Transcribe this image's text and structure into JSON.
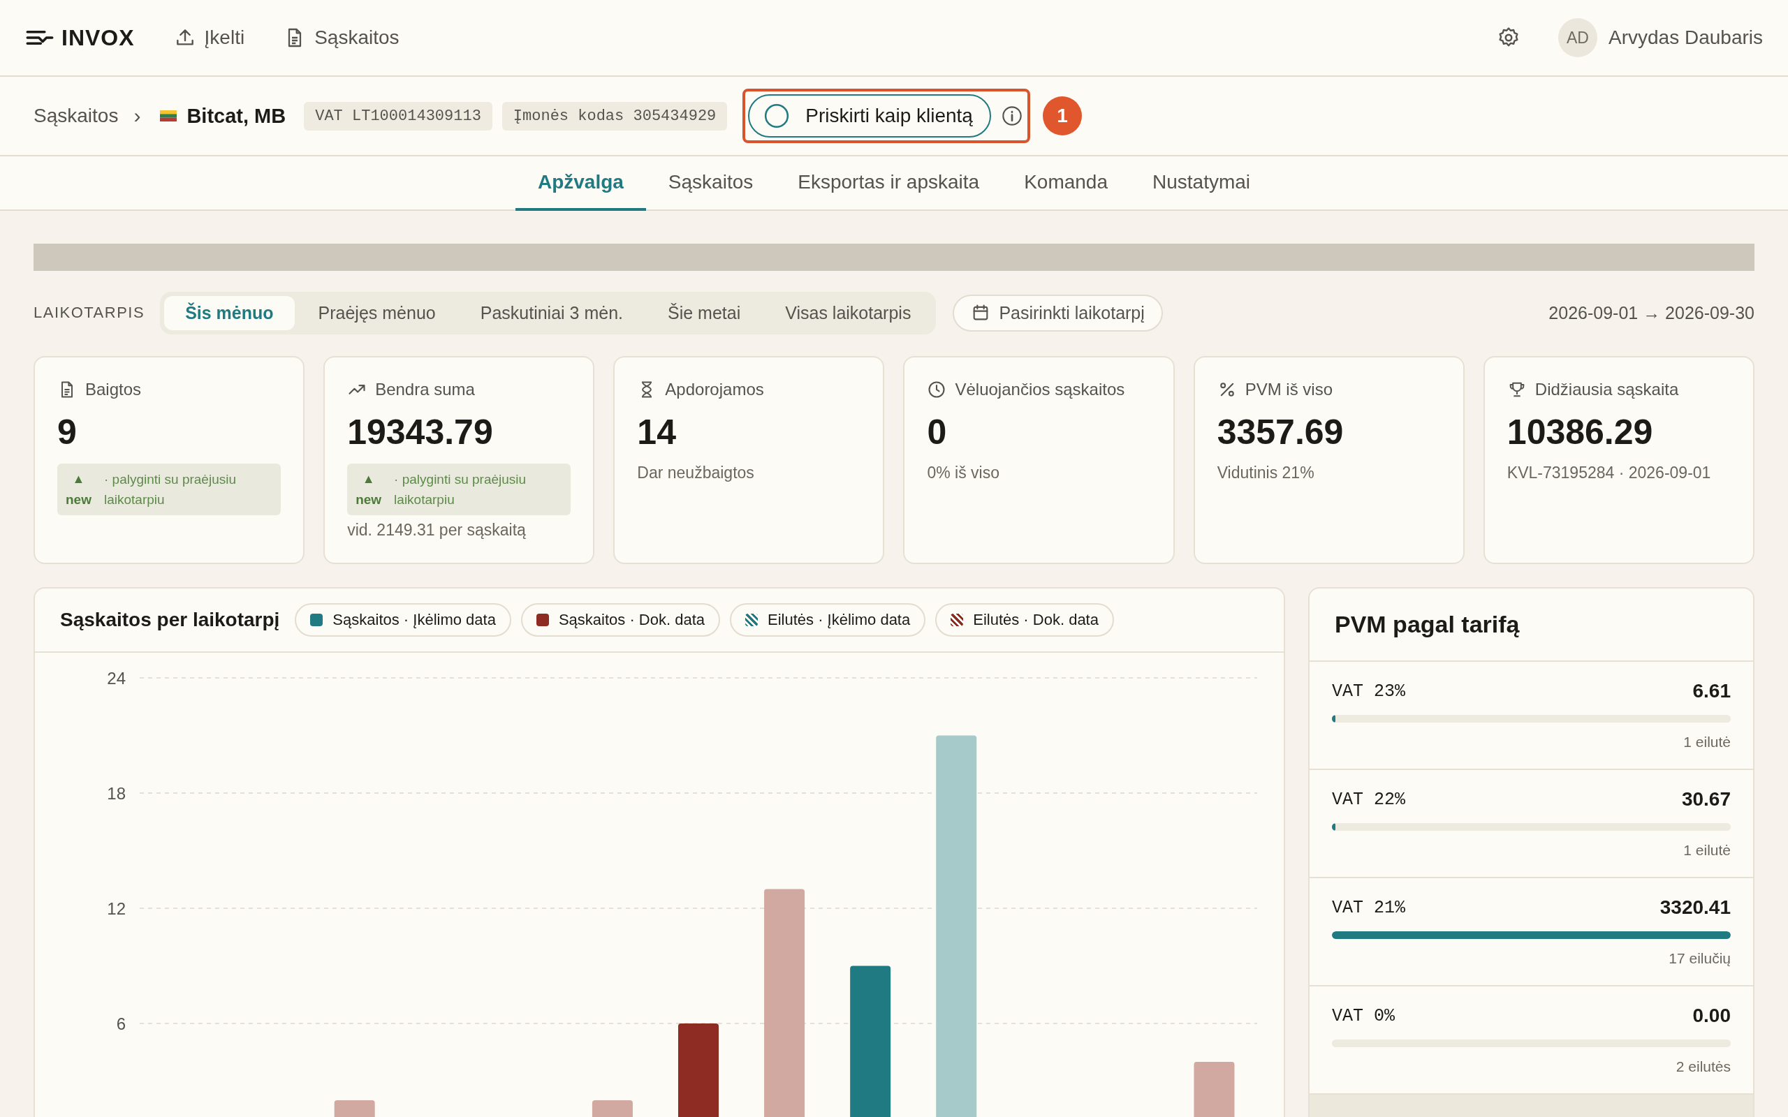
{
  "app": {
    "logo": "INVOX",
    "nav": [
      {
        "label": "Įkelti"
      },
      {
        "label": "Sąskaitos"
      }
    ],
    "user": {
      "initials": "AD",
      "name": "Arvydas Daubaris"
    }
  },
  "breadcrumb": {
    "parent": "Sąskaitos",
    "separator": "›",
    "company": "Bitcat, MB",
    "chips": [
      "VAT LT100014309113",
      "Įmonės kodas 305434929"
    ],
    "assign_button": "Priskirti kaip klientą",
    "step_badge": "1"
  },
  "tabs": [
    {
      "label": "Apžvalga",
      "selected": true
    },
    {
      "label": "Sąskaitos",
      "selected": false
    },
    {
      "label": "Eksportas ir apskaita",
      "selected": false
    },
    {
      "label": "Komanda",
      "selected": false
    },
    {
      "label": "Nustatymai",
      "selected": false
    }
  ],
  "period": {
    "label": "LAIKOTARPIS",
    "options": [
      {
        "label": "Šis mėnuo",
        "selected": true
      },
      {
        "label": "Praėjęs mėnuo",
        "selected": false
      },
      {
        "label": "Paskutiniai 3 mėn.",
        "selected": false
      },
      {
        "label": "Šie metai",
        "selected": false
      },
      {
        "label": "Visas laikotarpis",
        "selected": false
      }
    ],
    "custom_button": "Pasirinkti laikotarpį",
    "range": "2026-09-01 → 2026-09-30"
  },
  "stats": [
    {
      "title": "Baigtos",
      "value": "9",
      "delta": {
        "arrow": "▲",
        "label": "new",
        "text": "· palyginti su praėjusiu laikotarpiu"
      }
    },
    {
      "title": "Bendra suma",
      "value": "19343.79",
      "delta": {
        "arrow": "▲",
        "label": "new",
        "text": "· palyginti su praėjusiu laikotarpiu"
      },
      "note": "vid. 2149.31 per sąskaitą"
    },
    {
      "title": "Apdorojamos",
      "value": "14",
      "note": "Dar neužbaigtos"
    },
    {
      "title": "Vėluojančios sąskaitos",
      "value": "0",
      "note": "0% iš viso"
    },
    {
      "title": "PVM iš viso",
      "value": "3357.69",
      "note": "Vidutinis 21%"
    },
    {
      "title": "Didžiausia sąskaita",
      "value": "10386.29",
      "note": "KVL-73195284 · 2026-09-01"
    }
  ],
  "invoices_chart": {
    "title": "Sąskaitos per laikotarpį",
    "swatches": [
      {
        "kind": "solid",
        "color": "#1f7a82"
      },
      {
        "kind": "solid",
        "color": "#8e2b22"
      },
      {
        "kind": "striped",
        "color": "#1f7a82"
      },
      {
        "kind": "striped",
        "color": "#8e2b22"
      }
    ],
    "chart_data": {
      "type": "bar",
      "grid": true,
      "ylim": [
        0,
        24
      ],
      "yticks": [
        6,
        12,
        18,
        24
      ],
      "series": [
        {
          "name": "Sąskaitos · Įkėlimo data",
          "color": "#1f7a82",
          "values": [
            null,
            null,
            null,
            null,
            null,
            null,
            null,
            null,
            9,
            null,
            null,
            null,
            null
          ]
        },
        {
          "name": "Sąskaitos · Dok. data",
          "color": "#8e2b22",
          "values": [
            null,
            null,
            null,
            null,
            null,
            null,
            6,
            null,
            null,
            null,
            null,
            null,
            null
          ]
        },
        {
          "name": "Eilutės · Įkėlimo data",
          "color": "#a6c9c9",
          "values": [
            null,
            null,
            null,
            null,
            null,
            null,
            null,
            null,
            null,
            21,
            null,
            null,
            null
          ]
        },
        {
          "name": "Eilutės · Dok. data",
          "color": "#d1a9a0",
          "values": [
            null,
            null,
            2,
            null,
            null,
            2,
            null,
            13,
            null,
            null,
            null,
            null,
            4
          ]
        }
      ]
    }
  },
  "vat_by_rate": {
    "title": "PVM pagal tarifą",
    "rows": [
      {
        "rate": "VAT 23%",
        "amount": "6.61",
        "level": 0.002,
        "count": "1 eilutė"
      },
      {
        "rate": "VAT 22%",
        "amount": "30.67",
        "level": 0.009,
        "count": "1 eilutė"
      },
      {
        "rate": "VAT 21%",
        "amount": "3320.41",
        "level": 1,
        "count": "17 eilučių"
      },
      {
        "rate": "VAT 0%",
        "amount": "0.00",
        "level": 0,
        "count": "2 eilutės"
      }
    ]
  }
}
